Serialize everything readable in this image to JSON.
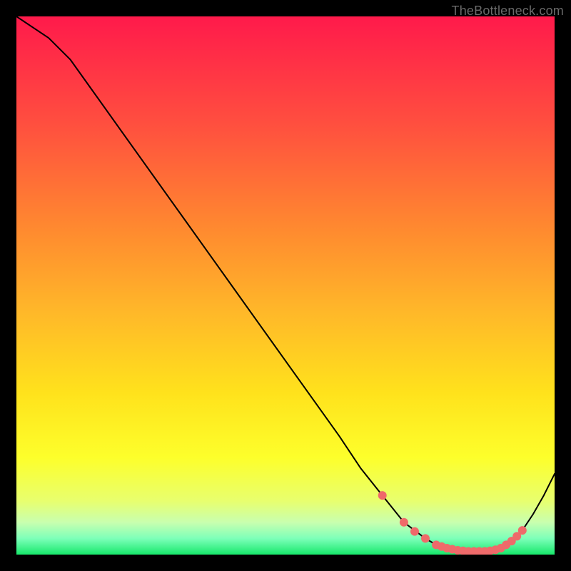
{
  "watermark": "TheBottleneck.com",
  "gradient_stops": [
    {
      "offset": 0.0,
      "color": "#ff1a4b"
    },
    {
      "offset": 0.2,
      "color": "#ff4f3f"
    },
    {
      "offset": 0.4,
      "color": "#ff8b2f"
    },
    {
      "offset": 0.55,
      "color": "#ffb829"
    },
    {
      "offset": 0.7,
      "color": "#ffe21c"
    },
    {
      "offset": 0.82,
      "color": "#fdff2b"
    },
    {
      "offset": 0.9,
      "color": "#e8ff6e"
    },
    {
      "offset": 0.94,
      "color": "#c9ffaf"
    },
    {
      "offset": 0.97,
      "color": "#7dffb9"
    },
    {
      "offset": 1.0,
      "color": "#17e86b"
    }
  ],
  "chart_data": {
    "type": "line",
    "title": "",
    "xlabel": "",
    "ylabel": "",
    "xlim": [
      0,
      100
    ],
    "ylim": [
      0,
      100
    ],
    "grid": false,
    "x": [
      0,
      6,
      10,
      15,
      20,
      25,
      30,
      35,
      40,
      45,
      50,
      55,
      60,
      64,
      68,
      72,
      76,
      78,
      80,
      82,
      84,
      86,
      87,
      88,
      90,
      92,
      94,
      96,
      98,
      100
    ],
    "values": [
      100,
      96,
      92,
      85,
      78,
      71,
      64,
      57,
      50,
      43,
      36,
      29,
      22,
      16,
      11,
      6,
      3,
      1.8,
      1.2,
      0.8,
      0.6,
      0.6,
      0.6,
      0.7,
      1.2,
      2.5,
      4.5,
      7.5,
      11,
      15
    ],
    "markers_x": [
      68,
      72,
      74,
      76,
      78,
      79,
      80,
      81,
      82,
      83,
      84,
      85,
      86,
      87,
      88,
      89,
      90,
      91,
      92,
      93,
      94
    ],
    "markers_y": [
      11,
      6,
      4.3,
      3,
      1.8,
      1.5,
      1.2,
      1.0,
      0.8,
      0.7,
      0.6,
      0.6,
      0.6,
      0.6,
      0.7,
      0.9,
      1.2,
      1.8,
      2.5,
      3.4,
      4.5
    ],
    "marker_color": "#ef6a6a",
    "marker_radius": 6
  }
}
